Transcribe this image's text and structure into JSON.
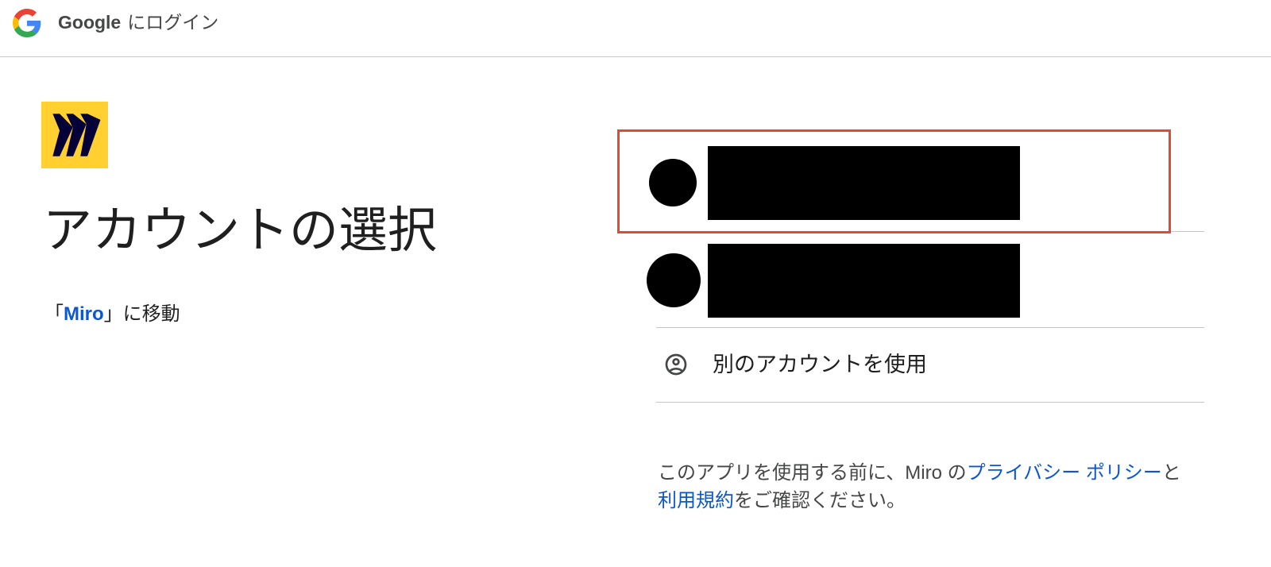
{
  "header": {
    "logo_icon": "google-g-logo",
    "brand": "Google",
    "suffix": "にログイン"
  },
  "app": {
    "logo_icon": "miro-logo"
  },
  "main": {
    "title": "アカウントの選択",
    "continue_prefix": "「",
    "continue_app": "Miro",
    "continue_suffix": "」に移動"
  },
  "account_list": {
    "accounts": [
      {
        "redacted": true,
        "highlighted": true
      },
      {
        "redacted": true,
        "highlighted": false
      }
    ],
    "use_another": {
      "icon": "account-circle-icon",
      "label": "別のアカウントを使用"
    }
  },
  "consent": {
    "text_before": "このアプリを使用する前に、Miro の",
    "privacy_link": "プライバシー ポリシー",
    "text_and": "と",
    "terms_link": "利用規約",
    "text_after": "をご確認ください。"
  },
  "colors": {
    "text": "#1f1f1f",
    "muted": "#444746",
    "link": "#0b57d0",
    "divider": "#c4c7c5",
    "annotation": "#e34a33",
    "miro_yellow": "#ffd02f",
    "miro_navy": "#050038",
    "redaction": "#000000"
  }
}
